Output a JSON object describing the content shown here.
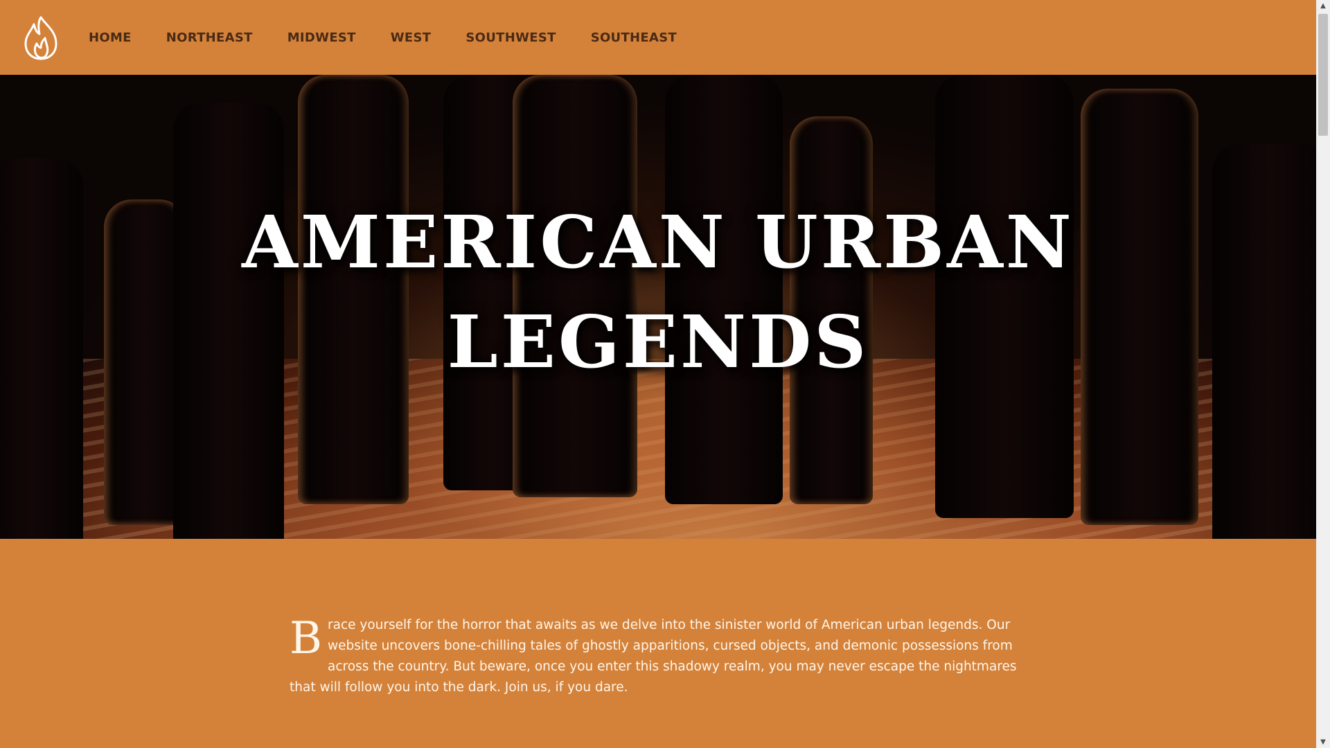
{
  "nav": {
    "logo_icon": "flame-icon",
    "items": [
      {
        "label": "HOME"
      },
      {
        "label": "NORTHEAST"
      },
      {
        "label": "MIDWEST"
      },
      {
        "label": "WEST"
      },
      {
        "label": "SOUTHWEST"
      },
      {
        "label": "SOUTHEAST"
      }
    ]
  },
  "hero": {
    "title_line1": "AMERICAN URBAN",
    "title_line2": "LEGENDS"
  },
  "intro": {
    "dropcap": "B",
    "text": "race yourself for the horror that awaits as we delve into the sinister world of American urban legends. Our website uncovers bone-chilling tales of ghostly apparitions, cursed objects, and demonic possessions from across the country. But beware, once you enter this shadowy realm, you may never escape the nightmares that will follow you into the dark. Join us, if you dare."
  },
  "colors": {
    "page_bg": "#d4823a",
    "nav_text": "#4a2a14",
    "hero_title": "#ffffff",
    "intro_text": "#fff6ea"
  }
}
